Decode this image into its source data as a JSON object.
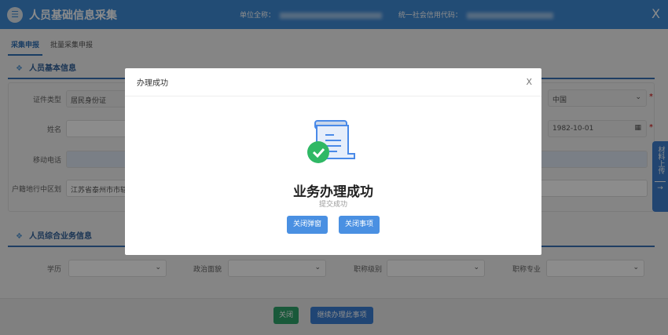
{
  "header": {
    "title": "人员基础信息采集",
    "unit_label": "单位全称：",
    "credit_label": "统一社会信用代码：",
    "close": "X"
  },
  "tabs": [
    {
      "label": "采集申报"
    },
    {
      "label": "批量采集申报"
    }
  ],
  "section1": {
    "title": "人员基本信息",
    "fields": [
      {
        "label": "证件类型",
        "value": "居民身份证"
      },
      {
        "label": "姓名",
        "value": ""
      },
      {
        "label": "移动电话",
        "value": ""
      },
      {
        "label": "户籍地行中区划",
        "value": "江苏省泰州市市辖区"
      }
    ],
    "right": [
      {
        "value": "中国"
      },
      {
        "value": "1982-10-01"
      }
    ]
  },
  "section2": {
    "title": "人员综合业务信息",
    "fields": [
      {
        "label": "学历"
      },
      {
        "label": "政治面貌"
      },
      {
        "label": "职称级别"
      },
      {
        "label": "职称专业"
      }
    ]
  },
  "side_tab": {
    "label": "材料上传",
    "arrow": "→"
  },
  "footer": {
    "close": "关闭",
    "continue": "继续办理此事项"
  },
  "modal": {
    "title": "办理成功",
    "close": "X",
    "heading": "业务办理成功",
    "subtext": "提交成功",
    "btn_close_popup": "关闭弹窗",
    "btn_close_item": "关闭事项"
  }
}
